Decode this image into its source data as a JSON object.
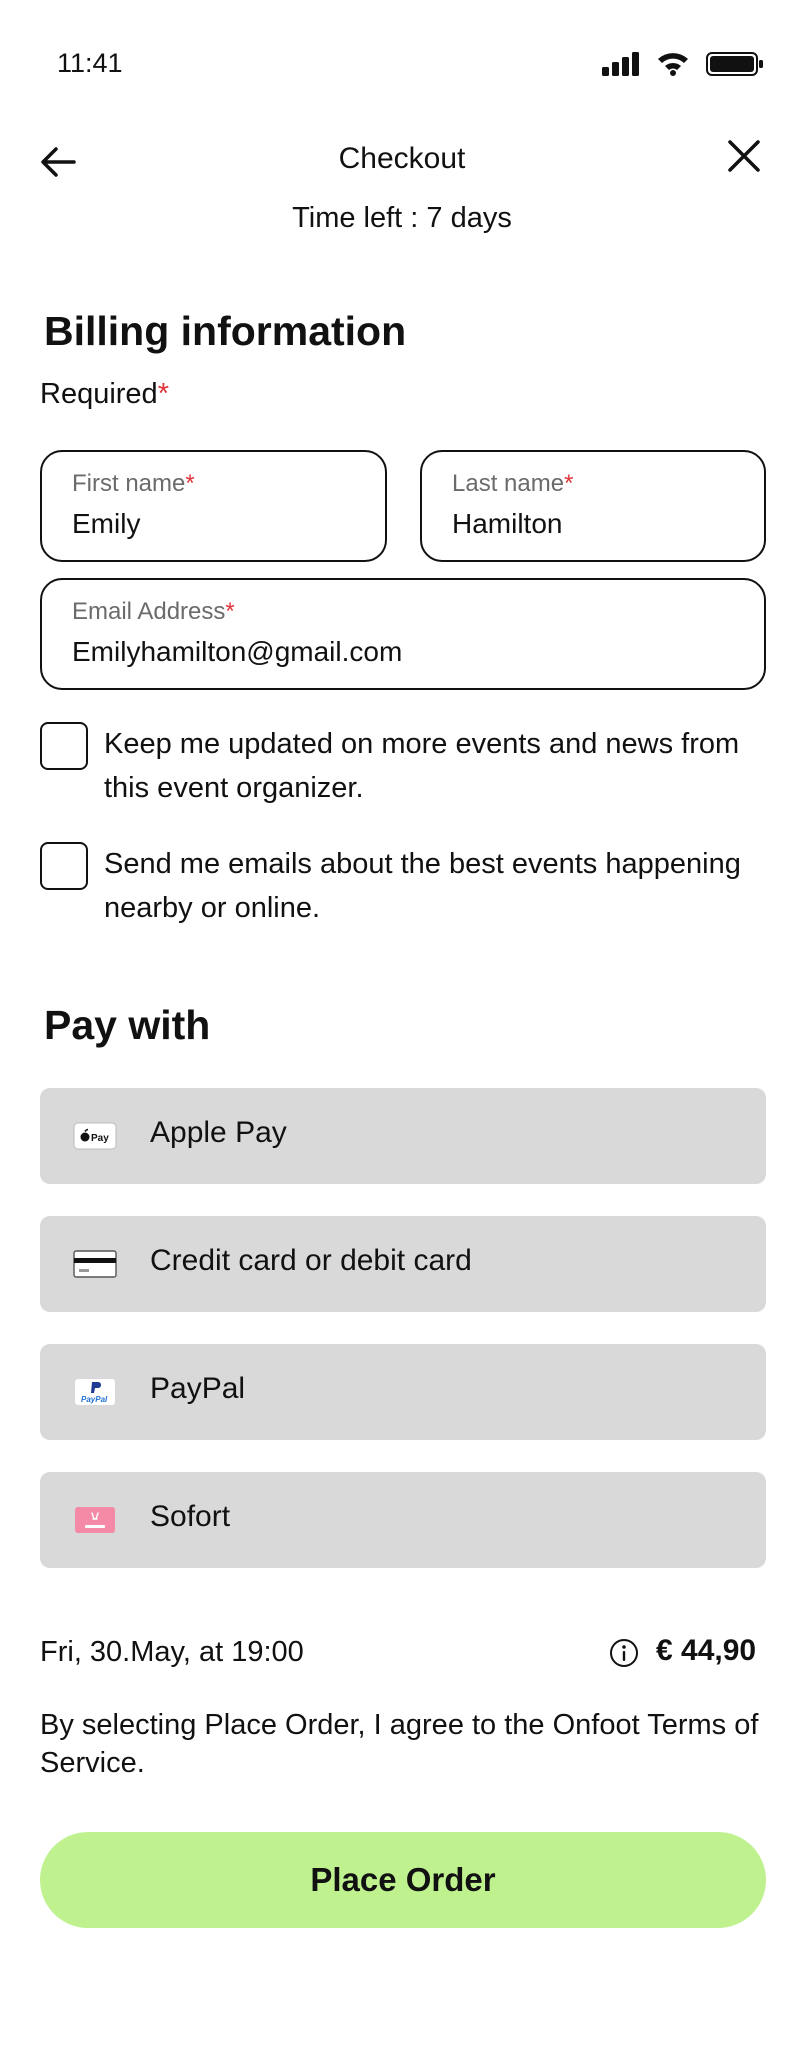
{
  "status_bar": {
    "time": "11:41"
  },
  "nav": {
    "title": "Checkout",
    "subtitle": "Time left : 7 days"
  },
  "billing": {
    "title": "Billing information",
    "required_label": "Required",
    "asterisk": "*",
    "first_name": {
      "label": "First name",
      "value": "Emily"
    },
    "last_name": {
      "label": "Last name",
      "value": "Hamilton"
    },
    "email": {
      "label": "Email Address",
      "value": "Emilyhamilton@gmail.com"
    },
    "checkboxes": [
      {
        "text": "Keep me updated on more events and news from this event organizer.",
        "checked": false
      },
      {
        "text": "Send me emails about the best events happening nearby or online.",
        "checked": false
      }
    ]
  },
  "payment": {
    "title": "Pay with",
    "options": [
      {
        "label": "Apple Pay",
        "icon": "apple-pay-icon"
      },
      {
        "label": "Credit card or debit card",
        "icon": "credit-card-icon"
      },
      {
        "label": "PayPal",
        "icon": "paypal-icon"
      },
      {
        "label": "Sofort",
        "icon": "sofort-icon"
      }
    ]
  },
  "summary": {
    "date": "Fri, 30.May, at 19:00",
    "price": "€ 44,90",
    "terms": "By selecting Place Order, I agree to the Onfoot Terms of Service."
  },
  "cta": {
    "label": "Place Order"
  },
  "colors": {
    "accent_green": "#bff28f",
    "option_gray": "#d9d9d9",
    "required_red": "#e0343a"
  }
}
